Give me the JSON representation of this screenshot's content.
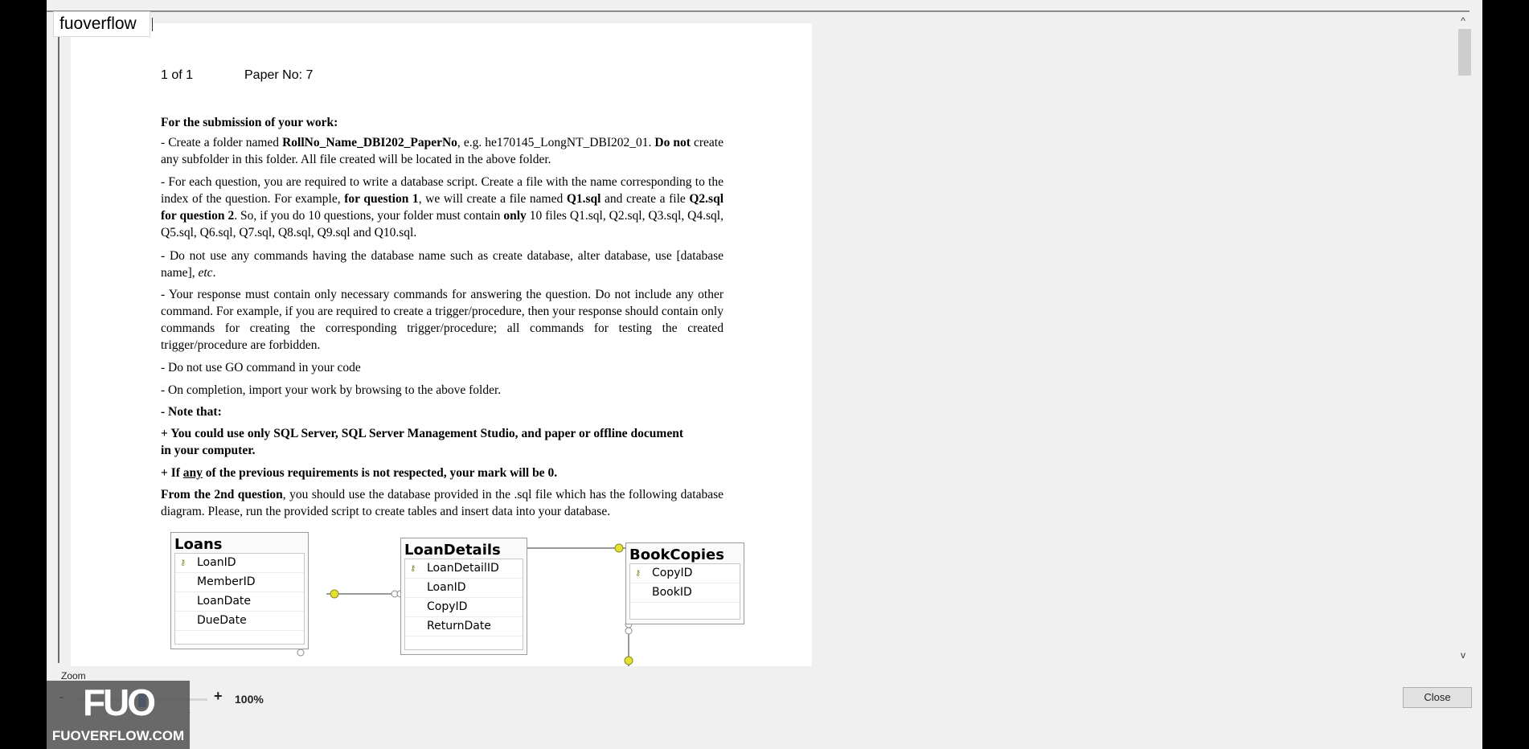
{
  "tab": {
    "label": "fuoverflow"
  },
  "document": {
    "page_counter": "1 of 1",
    "paper_no": "Paper No: 7",
    "submission_heading": "For the submission of your work:",
    "para1": {
      "a": "- Create a folder named ",
      "b": "RollNo_Name_DBI202_PaperNo",
      "c": ", e.g. he170145_LongNT_DBI202_01. ",
      "d": "Do not",
      "e": " create any subfolder in this folder. All file created will be located in the above folder."
    },
    "para2": {
      "a": "- For each question, you are required to write a database script. Create a file with the name corresponding to the index of the question. For example, ",
      "b": "for question 1",
      "c": ", we will create a file named ",
      "d": "Q1.sql",
      "e": " and create a file ",
      "f": "Q2.sql for question 2",
      "g": ". So, if you do 10 questions, your folder must contain ",
      "h": "only",
      "i": " 10 files Q1.sql, Q2.sql, Q3.sql, Q4.sql, Q5.sql, Q6.sql, Q7.sql, Q8.sql, Q9.sql and Q10.sql."
    },
    "para3": {
      "a": "- Do not use any commands having the database name such as create database, alter database, use [database name], ",
      "b": "etc",
      "c": "."
    },
    "para4": "- Your response must contain only necessary commands for answering the question. Do not include any other command. For example, if you are required to create a trigger/procedure, then your response should contain only commands for creating the corresponding trigger/procedure; all commands for testing the created trigger/procedure are forbidden.",
    "para5": "- Do not use GO command in your code",
    "para6": "- On completion, import your work by browsing to the above folder.",
    "note_heading": "- Note that:",
    "note1": "+ You could use only SQL Server, SQL Server Management Studio, and paper or offline document in your computer.",
    "note2": {
      "a": "+ If ",
      "b": "any",
      "c": " of the previous requirements is not respected, your mark will be 0."
    },
    "para7": {
      "a": "From the 2nd question",
      "b": ", you should use the database provided in the .sql file which has the following database diagram. Please, run the provided script to create tables and insert data into your database."
    }
  },
  "diagram": {
    "tables": [
      {
        "name": "Loans",
        "columns": [
          "LoanID",
          "MemberID",
          "LoanDate",
          "DueDate"
        ],
        "key": "LoanID"
      },
      {
        "name": "LoanDetails",
        "columns": [
          "LoanDetailID",
          "LoanID",
          "CopyID",
          "ReturnDate"
        ],
        "key": "LoanDetailID"
      },
      {
        "name": "BookCopies",
        "columns": [
          "CopyID",
          "BookID"
        ],
        "key": "CopyID"
      }
    ],
    "key_icon": "key-icon",
    "relationship_color": "#e8e030"
  },
  "zoom": {
    "label": "Zoom",
    "minus": "-",
    "plus": "+",
    "value": "100%"
  },
  "close_button": {
    "label": "Close"
  },
  "watermark": {
    "logo": "FUO",
    "site": "FUOVERFLOW.COM"
  },
  "scrollbar": {
    "up": "^",
    "down": "v"
  }
}
